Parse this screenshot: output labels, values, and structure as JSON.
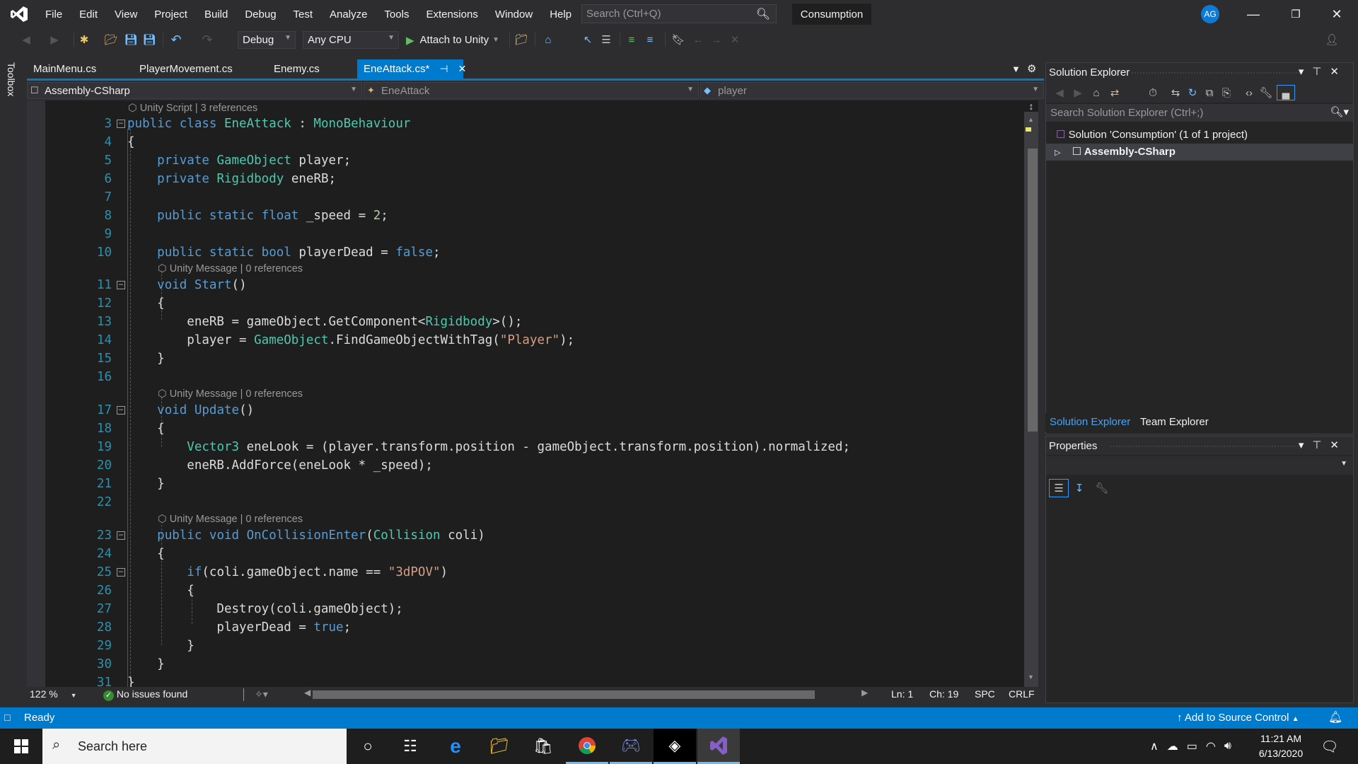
{
  "titlebar": {
    "menu": [
      "File",
      "Edit",
      "View",
      "Project",
      "Build",
      "Debug",
      "Test",
      "Analyze",
      "Tools",
      "Extensions",
      "Window",
      "Help"
    ],
    "search_placeholder": "Search (Ctrl+Q)",
    "solution_name": "Consumption",
    "avatar_initials": "AG"
  },
  "toolbar": {
    "configuration": "Debug",
    "platform": "Any CPU",
    "attach_label": "Attach to Unity"
  },
  "toolbox_label": "Toolbox",
  "tabs": [
    {
      "label": "MainMenu.cs",
      "active": false
    },
    {
      "label": "PlayerMovement.cs",
      "active": false
    },
    {
      "label": "Enemy.cs",
      "active": false
    },
    {
      "label": "EneAttack.cs*",
      "active": true
    }
  ],
  "navbar": {
    "project": "Assembly-CSharp",
    "type": "EneAttack",
    "member": "player"
  },
  "code_lens": {
    "class": "Unity Script | 3 references",
    "start": "Unity Message | 0 references",
    "update": "Unity Message | 0 references",
    "collision": "Unity Message | 0 references"
  },
  "code": [
    {
      "n": "3",
      "text": "public class EneAttack : MonoBehaviour"
    },
    {
      "n": "4",
      "text": "{"
    },
    {
      "n": "5",
      "text": "    private GameObject player;"
    },
    {
      "n": "6",
      "text": "    private Rigidbody eneRB;"
    },
    {
      "n": "7",
      "text": ""
    },
    {
      "n": "8",
      "text": "    public static float _speed = 2;"
    },
    {
      "n": "9",
      "text": ""
    },
    {
      "n": "10",
      "text": "    public static bool playerDead = false;"
    },
    {
      "n": "11",
      "text": "    void Start()"
    },
    {
      "n": "12",
      "text": "    {"
    },
    {
      "n": "13",
      "text": "        eneRB = gameObject.GetComponent<Rigidbody>();"
    },
    {
      "n": "14",
      "text": "        player = GameObject.FindGameObjectWithTag(\"Player\");"
    },
    {
      "n": "15",
      "text": "    }"
    },
    {
      "n": "16",
      "text": ""
    },
    {
      "n": "17",
      "text": "    void Update()"
    },
    {
      "n": "18",
      "text": "    {"
    },
    {
      "n": "19",
      "text": "        Vector3 eneLook = (player.transform.position - gameObject.transform.position).normalized;"
    },
    {
      "n": "20",
      "text": "        eneRB.AddForce(eneLook * _speed);"
    },
    {
      "n": "21",
      "text": "    }"
    },
    {
      "n": "22",
      "text": ""
    },
    {
      "n": "23",
      "text": "    public void OnCollisionEnter(Collision coli)"
    },
    {
      "n": "24",
      "text": "    {"
    },
    {
      "n": "25",
      "text": "        if(coli.gameObject.name == \"3dPOV\")"
    },
    {
      "n": "26",
      "text": "        {"
    },
    {
      "n": "27",
      "text": "            Destroy(coli.gameObject);"
    },
    {
      "n": "28",
      "text": "            playerDead = true;"
    },
    {
      "n": "29",
      "text": "        }"
    },
    {
      "n": "30",
      "text": "    }"
    },
    {
      "n": "31",
      "text": "}"
    }
  ],
  "editor_bottom": {
    "zoom": "122 %",
    "issues": "No issues found",
    "line": "Ln: 1",
    "char": "Ch: 19",
    "whitespace": "SPC",
    "line_ending": "CRLF"
  },
  "solution_explorer": {
    "title": "Solution Explorer",
    "search_placeholder": "Search Solution Explorer (Ctrl+;)",
    "solution_node": "Solution 'Consumption' (1 of 1 project)",
    "project_node": "Assembly-CSharp",
    "bottom_tabs": [
      "Solution Explorer",
      "Team Explorer"
    ]
  },
  "properties": {
    "title": "Properties"
  },
  "status": {
    "ready": "Ready",
    "source_control": "Add to Source Control"
  },
  "taskbar": {
    "search_placeholder": "Search here",
    "time": "11:21 AM",
    "date": "6/13/2020"
  },
  "colors": {
    "accent": "#007acc",
    "keyword": "#569cd6",
    "type": "#4ec9b0",
    "string": "#d69d85",
    "line_number": "#2b91af"
  }
}
